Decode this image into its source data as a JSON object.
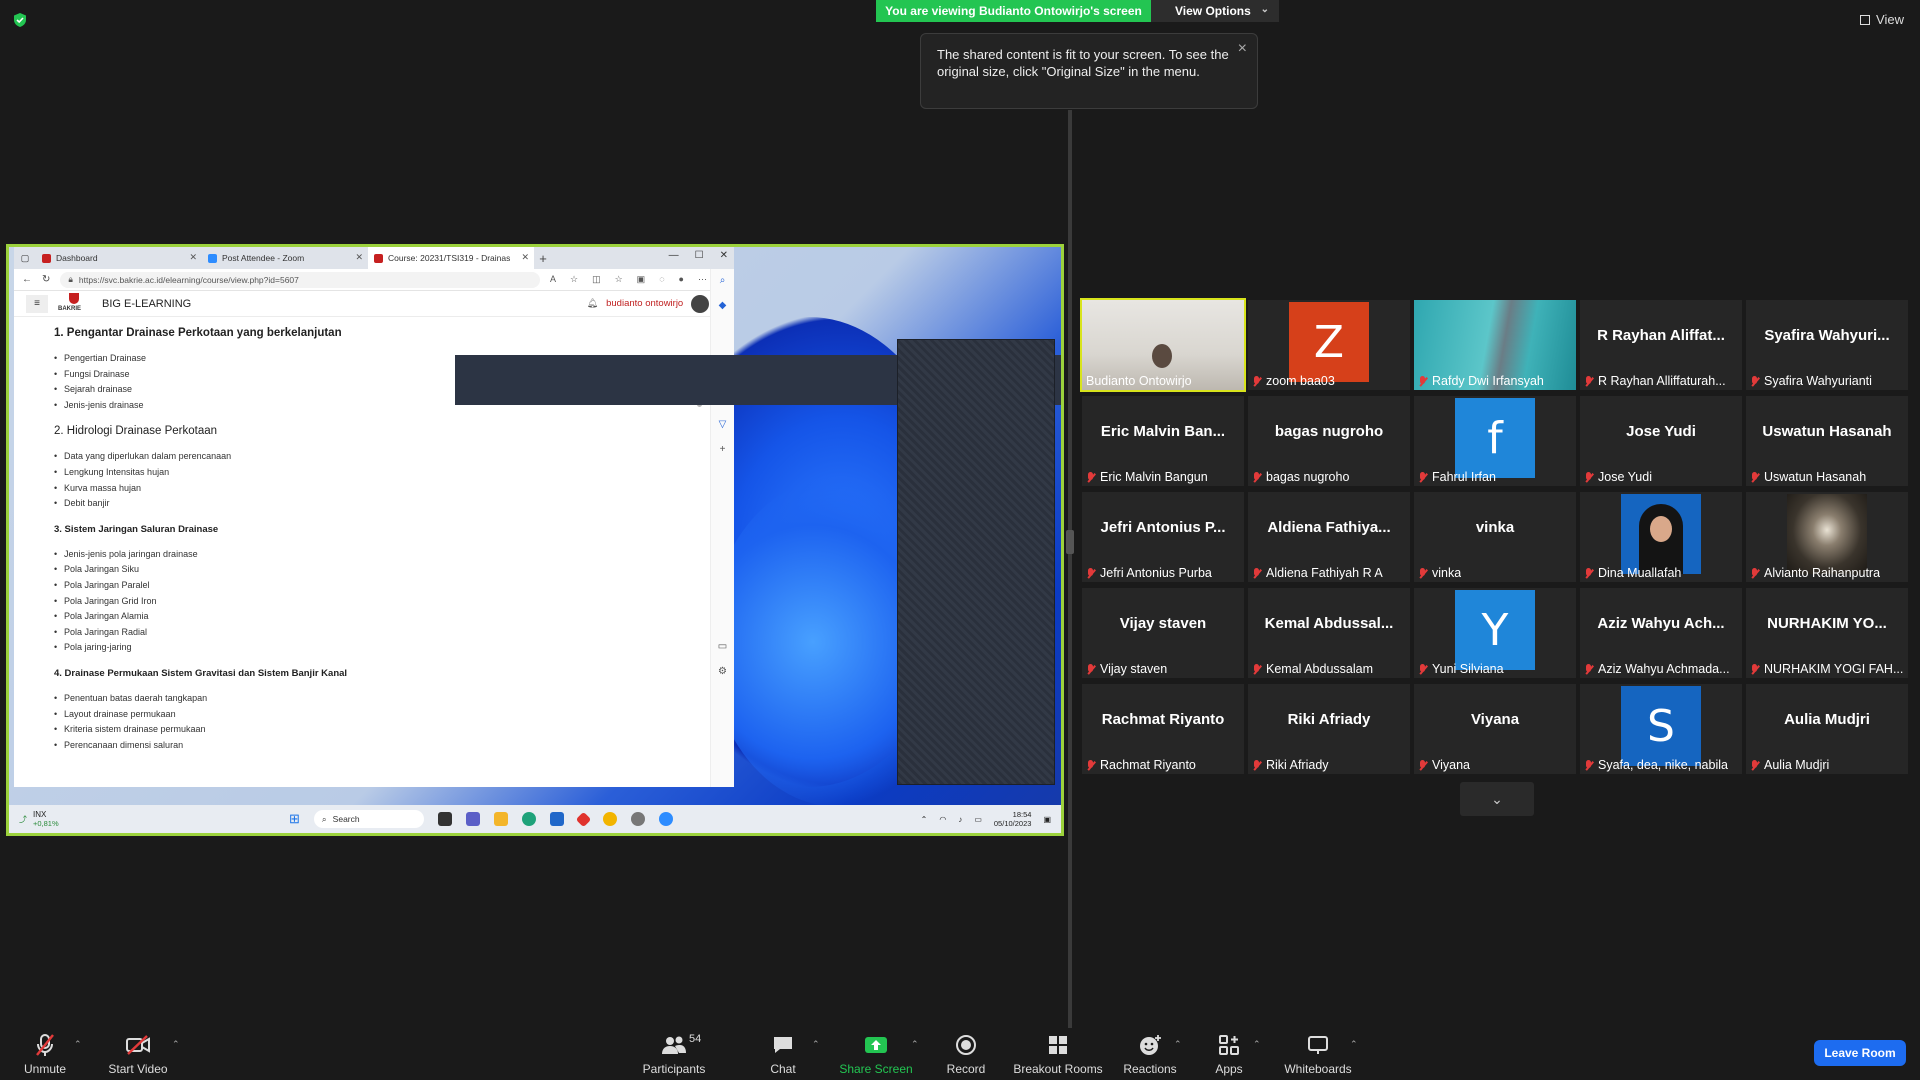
{
  "app": {
    "banner": "You are viewing Budianto Ontowirjo's screen",
    "view_options": "View Options",
    "view_label": "View",
    "tooltip": "The shared content is fit to your screen. To see the original size, click \"Original Size\" in the menu.",
    "accent": "#23c552"
  },
  "browser": {
    "tabs": [
      {
        "label": "Dashboard",
        "fav_color": "#c62020"
      },
      {
        "label": "Post Attendee - Zoom",
        "fav_color": "#2d8cff"
      },
      {
        "label": "Course: 20231/TSI319 - Drainase",
        "fav_color": "#c62020"
      }
    ],
    "url": "https://svc.bakrie.ac.id/elearning/course/view.php?id=5607",
    "logo_text": "BAKRIE",
    "site_name": "BIG E-LEARNING",
    "user_name": "budianto ontowirjo"
  },
  "course": {
    "sections": [
      {
        "title": "1. Pengantar Drainase Perkotaan yang berkelanjutan",
        "style": "bold",
        "items": [
          "Pengertian Drainase",
          "Fungsi Drainase",
          "Sejarah drainase",
          "Jenis-jenis drainase"
        ]
      },
      {
        "title": "2. Hidrologi Drainase Perkotaan",
        "style": "normal",
        "items": [
          "Data yang diperlukan dalam perencanaan",
          "Lengkung Intensitas hujan",
          "Kurva massa hujan",
          "Debit banjir"
        ]
      },
      {
        "title": "3. Sistem Jaringan Saluran Drainase",
        "style": "small",
        "items": [
          "Jenis-jenis pola jaringan drainase",
          "Pola Jaringan Siku",
          "Pola Jaringan Paralel",
          "Pola Jaringan Grid Iron",
          "Pola Jaringan Alamia",
          "Pola Jaringan Radial",
          "Pola jaring-jaring"
        ]
      },
      {
        "title": "4. Drainase Permukaan Sistem Gravitasi dan Sistem Banjir Kanal",
        "style": "small",
        "items": [
          "Penentuan batas daerah tangkapan",
          "Layout drainase permukaan",
          "Kriteria sistem drainase permukaan",
          "Perencanaan dimensi saluran"
        ]
      }
    ]
  },
  "taskbar": {
    "stock_name": "INX",
    "stock_change": "+0,81%",
    "search": "Search",
    "time": "18:54",
    "date": "05/10/2023"
  },
  "participants": [
    {
      "big": "",
      "name": "Budianto Ontowirjo",
      "kind": "video",
      "active": true
    },
    {
      "big": "Z",
      "name": "zoom baa03",
      "kind": "avatar",
      "color": "#d6401a"
    },
    {
      "big": "",
      "name": "Rafdy Dwi Irfansyah",
      "kind": "photo-teal"
    },
    {
      "big": "R Rayhan Aliffat...",
      "name": "R Rayhan Alliffaturah...",
      "kind": "text"
    },
    {
      "big": "Syafira  Wahyuri...",
      "name": "Syafira Wahyurianti",
      "kind": "text"
    },
    {
      "big": "Eric  Malvin  Ban...",
      "name": "Eric Malvin Bangun",
      "kind": "text"
    },
    {
      "big": "bagas nugroho",
      "name": "bagas nugroho",
      "kind": "text"
    },
    {
      "big": "f",
      "name": "Fahrul Irfan",
      "kind": "avatar",
      "color": "#1f86d9"
    },
    {
      "big": "Jose Yudi",
      "name": "Jose Yudi",
      "kind": "text"
    },
    {
      "big": "Uswatun Hasanah",
      "name": "Uswatun Hasanah",
      "kind": "text"
    },
    {
      "big": "Jefri  Antonius  P...",
      "name": "Jefri Antonius Purba",
      "kind": "text"
    },
    {
      "big": "Aldiena  Fathiya...",
      "name": "Aldiena Fathiyah R A",
      "kind": "text"
    },
    {
      "big": "vinka",
      "name": "vinka",
      "kind": "text"
    },
    {
      "big": "",
      "name": "Dina Muallafah",
      "kind": "photo-person"
    },
    {
      "big": "",
      "name": "Alvianto Raihanputra",
      "kind": "photo-hall"
    },
    {
      "big": "Vijay staven",
      "name": "Vijay staven",
      "kind": "text"
    },
    {
      "big": "Kemal  Abdussal...",
      "name": "Kemal Abdussalam",
      "kind": "text"
    },
    {
      "big": "Y",
      "name": "Yuni Silviana",
      "kind": "avatar",
      "color": "#1f86d9"
    },
    {
      "big": "Aziz  Wahyu  Ach...",
      "name": "Aziz Wahyu Achmada...",
      "kind": "text"
    },
    {
      "big": "NURHAKIM  YO...",
      "name": "NURHAKIM YOGI FAH...",
      "kind": "text"
    },
    {
      "big": "Rachmat Riyanto",
      "name": "Rachmat Riyanto",
      "kind": "text"
    },
    {
      "big": "Riki Afriady",
      "name": "Riki Afriady",
      "kind": "text"
    },
    {
      "big": "Viyana",
      "name": "Viyana",
      "kind": "text"
    },
    {
      "big": "S",
      "name": "Syafa, dea, nike, nabila",
      "kind": "avatar",
      "color": "#1565c0"
    },
    {
      "big": "Aulia Mudjri",
      "name": "Aulia Mudjri",
      "kind": "text"
    }
  ],
  "toolbar": {
    "unmute": "Unmute",
    "start_video": "Start Video",
    "participants": "Participants",
    "participant_count": "54",
    "chat": "Chat",
    "share_screen": "Share Screen",
    "record": "Record",
    "breakout_rooms": "Breakout Rooms",
    "reactions": "Reactions",
    "apps": "Apps",
    "whiteboards": "Whiteboards",
    "leave_room": "Leave Room"
  }
}
